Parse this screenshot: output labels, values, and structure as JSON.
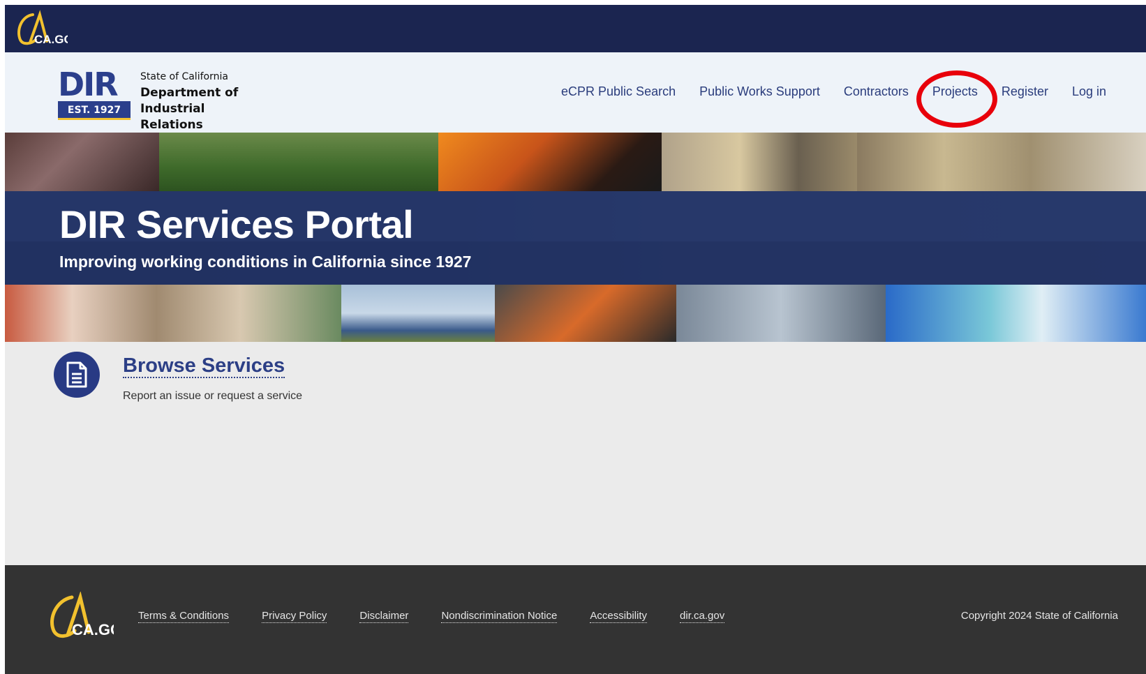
{
  "brand": {
    "ca_gov_logo": "CA.GOV",
    "org_line1": "State of California",
    "org_line2": "Department of",
    "org_line3": "Industrial Relations",
    "dir_est": "EST. 1927",
    "dir_mark": "DIR"
  },
  "nav": {
    "items": [
      {
        "label": "eCPR Public Search"
      },
      {
        "label": "Public Works Support"
      },
      {
        "label": "Contractors"
      },
      {
        "label": "Projects"
      },
      {
        "label": "Register"
      },
      {
        "label": "Log in"
      }
    ]
  },
  "hero": {
    "title": "DIR Services Portal",
    "subtitle": "Improving working conditions in California since 1927"
  },
  "main": {
    "browse_title": "Browse Services",
    "browse_desc": "Report an issue or request a service",
    "browse_icon": "document-icon"
  },
  "footer": {
    "links": [
      {
        "label": "Terms & Conditions"
      },
      {
        "label": "Privacy Policy"
      },
      {
        "label": "Disclaimer"
      },
      {
        "label": "Nondiscrimination Notice"
      },
      {
        "label": "Accessibility"
      },
      {
        "label": "dir.ca.gov"
      }
    ],
    "copyright": "Copyright 2024 State of California"
  },
  "colors": {
    "navy": "#1b2550",
    "link_blue": "#2a3c7c",
    "highlight_red": "#e8000b",
    "gold": "#f2c12e",
    "footer_bg": "#333333"
  }
}
